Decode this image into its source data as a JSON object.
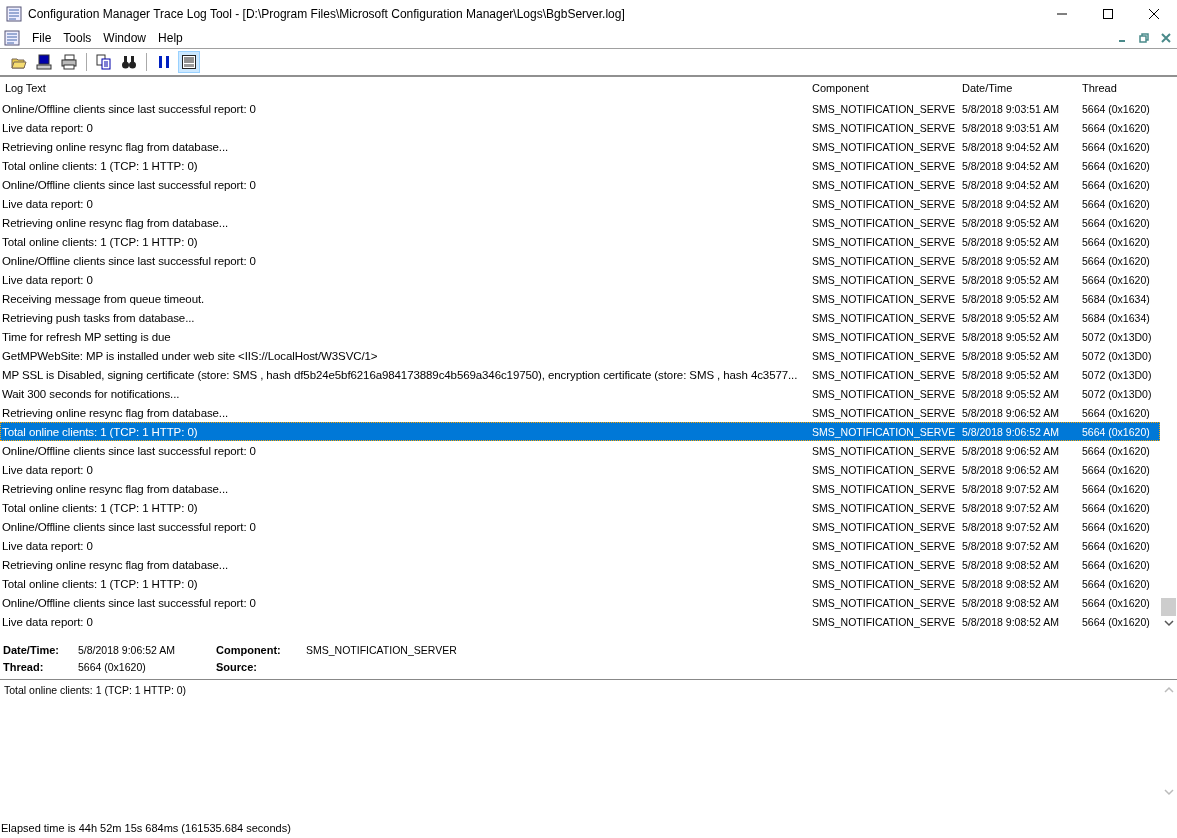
{
  "window": {
    "title": "Configuration Manager Trace Log Tool - [D:\\Program Files\\Microsoft Configuration Manager\\Logs\\BgbServer.log]"
  },
  "menu": [
    "File",
    "Tools",
    "Window",
    "Help"
  ],
  "toolbar": [
    [
      {
        "kind": "open",
        "pressed": false
      },
      {
        "kind": "computer",
        "pressed": false
      },
      {
        "kind": "print",
        "pressed": false
      }
    ],
    [
      {
        "kind": "copy",
        "pressed": false
      },
      {
        "kind": "find",
        "pressed": false
      }
    ],
    [
      {
        "kind": "pause",
        "pressed": false
      },
      {
        "kind": "details",
        "pressed": true
      }
    ]
  ],
  "table": {
    "columns": [
      "Log Text",
      "Component",
      "Date/Time",
      "Thread"
    ],
    "rows": [
      {
        "text": "Online/Offline clients since last successful report: 0",
        "component": "SMS_NOTIFICATION_SERVE",
        "datetime": "5/8/2018 9:03:51 AM",
        "thread": "5664 (0x1620)",
        "selected": false
      },
      {
        "text": "Live data report: 0",
        "component": "SMS_NOTIFICATION_SERVE",
        "datetime": "5/8/2018 9:03:51 AM",
        "thread": "5664 (0x1620)",
        "selected": false
      },
      {
        "text": "Retrieving online resync flag from database...",
        "component": "SMS_NOTIFICATION_SERVE",
        "datetime": "5/8/2018 9:04:52 AM",
        "thread": "5664 (0x1620)",
        "selected": false
      },
      {
        "text": "Total online clients: 1 (TCP: 1 HTTP: 0)",
        "component": "SMS_NOTIFICATION_SERVE",
        "datetime": "5/8/2018 9:04:52 AM",
        "thread": "5664 (0x1620)",
        "selected": false
      },
      {
        "text": "Online/Offline clients since last successful report: 0",
        "component": "SMS_NOTIFICATION_SERVE",
        "datetime": "5/8/2018 9:04:52 AM",
        "thread": "5664 (0x1620)",
        "selected": false
      },
      {
        "text": "Live data report: 0",
        "component": "SMS_NOTIFICATION_SERVE",
        "datetime": "5/8/2018 9:04:52 AM",
        "thread": "5664 (0x1620)",
        "selected": false
      },
      {
        "text": "Retrieving online resync flag from database...",
        "component": "SMS_NOTIFICATION_SERVE",
        "datetime": "5/8/2018 9:05:52 AM",
        "thread": "5664 (0x1620)",
        "selected": false
      },
      {
        "text": "Total online clients: 1 (TCP: 1 HTTP: 0)",
        "component": "SMS_NOTIFICATION_SERVE",
        "datetime": "5/8/2018 9:05:52 AM",
        "thread": "5664 (0x1620)",
        "selected": false
      },
      {
        "text": "Online/Offline clients since last successful report: 0",
        "component": "SMS_NOTIFICATION_SERVE",
        "datetime": "5/8/2018 9:05:52 AM",
        "thread": "5664 (0x1620)",
        "selected": false
      },
      {
        "text": "Live data report: 0",
        "component": "SMS_NOTIFICATION_SERVE",
        "datetime": "5/8/2018 9:05:52 AM",
        "thread": "5664 (0x1620)",
        "selected": false
      },
      {
        "text": "Receiving message from queue timeout.",
        "component": "SMS_NOTIFICATION_SERVE",
        "datetime": "5/8/2018 9:05:52 AM",
        "thread": "5684 (0x1634)",
        "selected": false
      },
      {
        "text": "Retrieving push tasks from database...",
        "component": "SMS_NOTIFICATION_SERVE",
        "datetime": "5/8/2018 9:05:52 AM",
        "thread": "5684 (0x1634)",
        "selected": false
      },
      {
        "text": "Time for refresh MP setting is due",
        "component": "SMS_NOTIFICATION_SERVE",
        "datetime": "5/8/2018 9:05:52 AM",
        "thread": "5072 (0x13D0)",
        "selected": false
      },
      {
        "text": "GetMPWebSite: MP is installed under web site <IIS://LocalHost/W3SVC/1>",
        "component": "SMS_NOTIFICATION_SERVE",
        "datetime": "5/8/2018 9:05:52 AM",
        "thread": "5072 (0x13D0)",
        "selected": false
      },
      {
        "text": "MP SSL is Disabled, signing certificate (store: SMS , hash df5b24e5bf6216a984173889c4b569a346c19750), encryption certificate (store: SMS , hash 4c3577...",
        "component": "SMS_NOTIFICATION_SERVE",
        "datetime": "5/8/2018 9:05:52 AM",
        "thread": "5072 (0x13D0)",
        "selected": false
      },
      {
        "text": "Wait 300 seconds for notifications...",
        "component": "SMS_NOTIFICATION_SERVE",
        "datetime": "5/8/2018 9:05:52 AM",
        "thread": "5072 (0x13D0)",
        "selected": false
      },
      {
        "text": "Retrieving online resync flag from database...",
        "component": "SMS_NOTIFICATION_SERVE",
        "datetime": "5/8/2018 9:06:52 AM",
        "thread": "5664 (0x1620)",
        "selected": false
      },
      {
        "text": "Total online clients: 1 (TCP: 1 HTTP: 0)",
        "component": "SMS_NOTIFICATION_SERVE",
        "datetime": "5/8/2018 9:06:52 AM",
        "thread": "5664 (0x1620)",
        "selected": true
      },
      {
        "text": "Online/Offline clients since last successful report: 0",
        "component": "SMS_NOTIFICATION_SERVE",
        "datetime": "5/8/2018 9:06:52 AM",
        "thread": "5664 (0x1620)",
        "selected": false
      },
      {
        "text": "Live data report: 0",
        "component": "SMS_NOTIFICATION_SERVE",
        "datetime": "5/8/2018 9:06:52 AM",
        "thread": "5664 (0x1620)",
        "selected": false
      },
      {
        "text": "Retrieving online resync flag from database...",
        "component": "SMS_NOTIFICATION_SERVE",
        "datetime": "5/8/2018 9:07:52 AM",
        "thread": "5664 (0x1620)",
        "selected": false
      },
      {
        "text": "Total online clients: 1 (TCP: 1 HTTP: 0)",
        "component": "SMS_NOTIFICATION_SERVE",
        "datetime": "5/8/2018 9:07:52 AM",
        "thread": "5664 (0x1620)",
        "selected": false
      },
      {
        "text": "Online/Offline clients since last successful report: 0",
        "component": "SMS_NOTIFICATION_SERVE",
        "datetime": "5/8/2018 9:07:52 AM",
        "thread": "5664 (0x1620)",
        "selected": false
      },
      {
        "text": "Live data report: 0",
        "component": "SMS_NOTIFICATION_SERVE",
        "datetime": "5/8/2018 9:07:52 AM",
        "thread": "5664 (0x1620)",
        "selected": false
      },
      {
        "text": "Retrieving online resync flag from database...",
        "component": "SMS_NOTIFICATION_SERVE",
        "datetime": "5/8/2018 9:08:52 AM",
        "thread": "5664 (0x1620)",
        "selected": false
      },
      {
        "text": "Total online clients: 1 (TCP: 1 HTTP: 0)",
        "component": "SMS_NOTIFICATION_SERVE",
        "datetime": "5/8/2018 9:08:52 AM",
        "thread": "5664 (0x1620)",
        "selected": false
      },
      {
        "text": "Online/Offline clients since last successful report: 0",
        "component": "SMS_NOTIFICATION_SERVE",
        "datetime": "5/8/2018 9:08:52 AM",
        "thread": "5664 (0x1620)",
        "selected": false
      },
      {
        "text": "Live data report: 0",
        "component": "SMS_NOTIFICATION_SERVE",
        "datetime": "5/8/2018 9:08:52 AM",
        "thread": "5664 (0x1620)",
        "selected": false
      }
    ]
  },
  "details": {
    "fields": [
      {
        "label": "Date/Time:",
        "value": "5/8/2018 9:06:52 AM"
      },
      {
        "label": "Component:",
        "value": "SMS_NOTIFICATION_SERVER"
      },
      {
        "label": "Thread:",
        "value": "5664 (0x1620)"
      },
      {
        "label": "Source:"
      }
    ],
    "message": "Total online clients: 1 (TCP: 1 HTTP: 0)"
  },
  "status_bar": "Elapsed time is 44h 52m 15s 684ms (161535.684 seconds)"
}
